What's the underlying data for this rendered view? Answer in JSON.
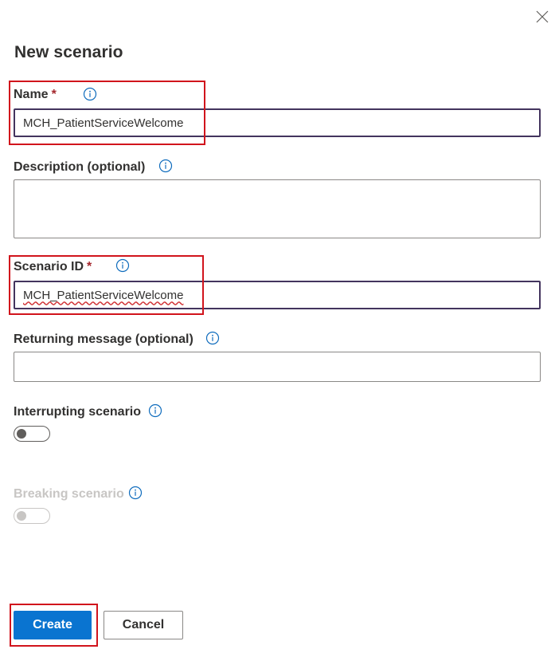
{
  "panel": {
    "title": "New scenario"
  },
  "fields": {
    "name": {
      "label": "Name",
      "required_mark": "*",
      "value": "MCH_PatientServiceWelcome"
    },
    "description": {
      "label": "Description (optional)",
      "value": ""
    },
    "scenario_id": {
      "label": "Scenario ID",
      "required_mark": "*",
      "value": "MCH_PatientServiceWelcome"
    },
    "returning_message": {
      "label": "Returning message (optional)",
      "value": ""
    }
  },
  "toggles": {
    "interrupting": {
      "label": "Interrupting scenario",
      "state": "off"
    },
    "breaking": {
      "label": "Breaking scenario",
      "state": "off",
      "disabled": true
    }
  },
  "actions": {
    "create_label": "Create",
    "cancel_label": "Cancel"
  },
  "colors": {
    "primary": "#0a74d0",
    "highlight": "#d1141c",
    "required": "#a4262c",
    "info_icon": "#0f6cbd",
    "focus_border": "#43345e"
  },
  "icons": {
    "close": "close-icon",
    "info": "info-icon"
  }
}
